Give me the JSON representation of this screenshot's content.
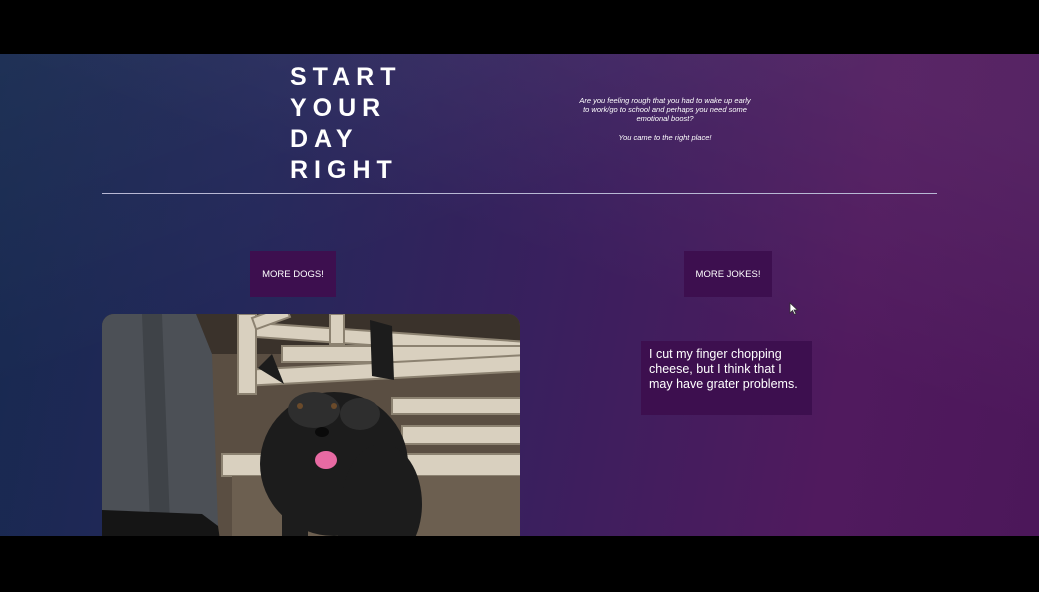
{
  "header": {
    "title_lines": [
      "START",
      "YOUR",
      "DAY",
      "RIGHT"
    ],
    "intro_text": "Are you feeling rough that you had to wake up early to work/go to school and perhaps you need some emotional boost?",
    "intro_tagline": "You came to the right place!"
  },
  "buttons": {
    "more_dogs": "MORE DOGS!",
    "more_jokes": "MORE JOKES!"
  },
  "joke": {
    "text": "I cut my finger chopping cheese, but I think that I may have grater problems."
  },
  "colors": {
    "button_bg": "#3d0f4f",
    "divider": "#b8b8d4",
    "background_start": "#16294f",
    "background_end": "#501a5e"
  },
  "icons": {
    "cursor": "pointer-cursor-icon"
  }
}
